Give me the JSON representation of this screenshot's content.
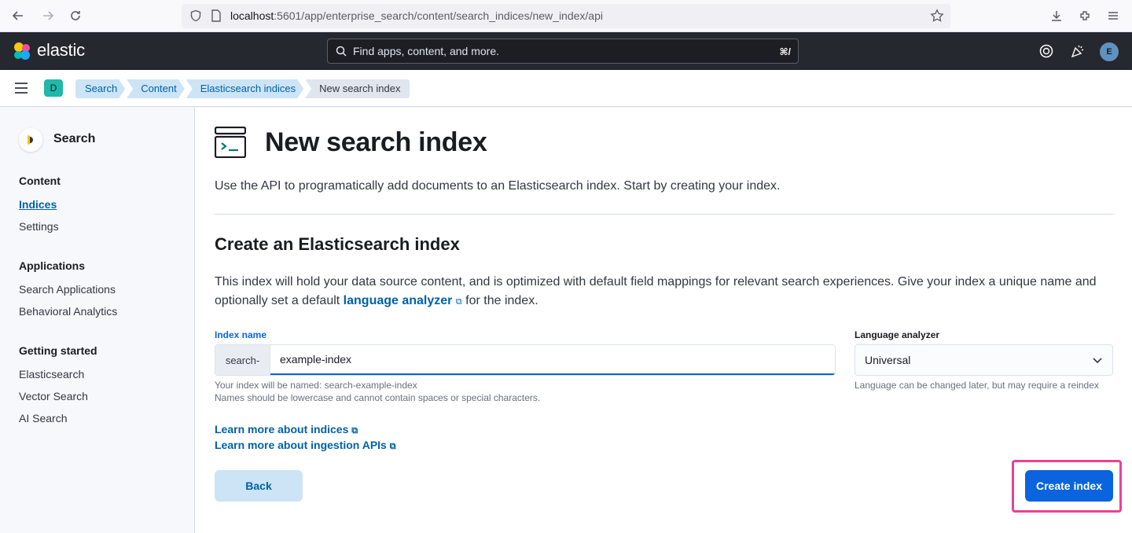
{
  "browser": {
    "url_host": "localhost",
    "url_rest": ":5601/app/enterprise_search/content/search_indices/new_index/api"
  },
  "header": {
    "logo": "elastic",
    "search_placeholder": "Find apps, content, and more.",
    "search_shortcut": "⌘/",
    "avatar_initial": "E"
  },
  "breadcrumbs": {
    "space_initial": "D",
    "items": [
      "Search",
      "Content",
      "Elasticsearch indices",
      "New search index"
    ]
  },
  "sidebar": {
    "title": "Search",
    "groups": [
      {
        "label": "Content",
        "items": [
          "Indices",
          "Settings"
        ]
      },
      {
        "label": "Applications",
        "items": [
          "Search Applications",
          "Behavioral Analytics"
        ]
      },
      {
        "label": "Getting started",
        "items": [
          "Elasticsearch",
          "Vector Search",
          "AI Search"
        ]
      }
    ],
    "active_item": "Indices"
  },
  "main": {
    "title": "New search index",
    "description": "Use the API to programatically add documents to an Elasticsearch index. Start by creating your index.",
    "section_title": "Create an Elasticsearch index",
    "section_desc_before": "This index will hold your data source content, and is optimized with default field mappings for relevant search experiences. Give your index a unique name and optionally set a default ",
    "section_desc_link": "language analyzer",
    "section_desc_after": " for the index.",
    "index_name_label": "Index name",
    "index_prefix": "search-",
    "index_value": "example-index",
    "index_help_1": "Your index will be named: search-example-index",
    "index_help_2": "Names should be lowercase and cannot contain spaces or special characters.",
    "language_label": "Language analyzer",
    "language_value": "Universal",
    "language_help": "Language can be changed later, but may require a reindex",
    "learn_indices": "Learn more about indices",
    "learn_ingestion": "Learn more about ingestion APIs",
    "back_label": "Back",
    "create_label": "Create index"
  },
  "colors": {
    "primary": "#0b64dd",
    "link": "#0061a6",
    "header_bg": "#25282f",
    "highlight": "#e84393"
  }
}
